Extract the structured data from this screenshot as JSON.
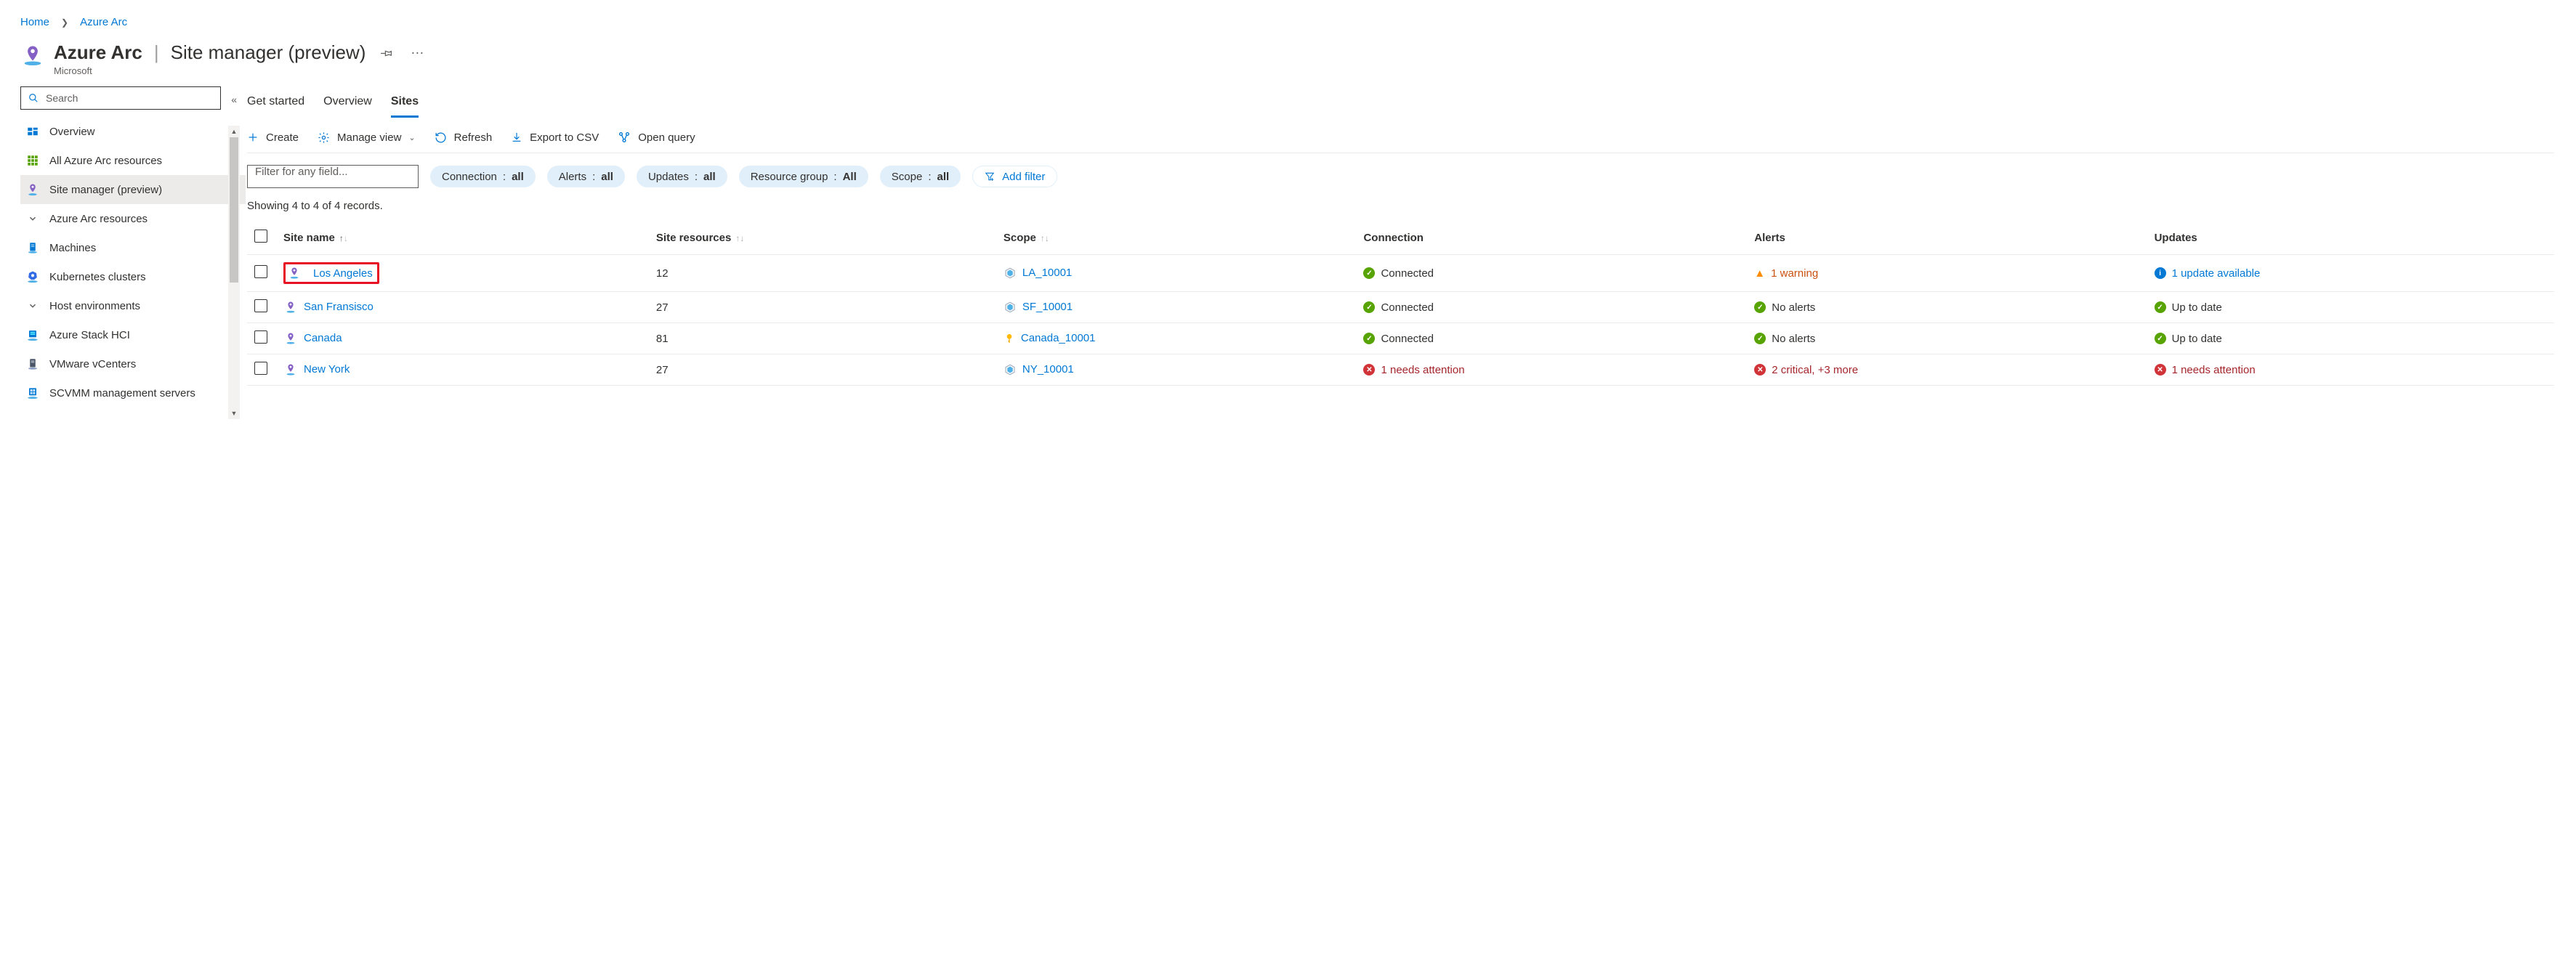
{
  "breadcrumb": {
    "home": "Home",
    "svc": "Azure Arc"
  },
  "header": {
    "service": "Azure Arc",
    "page": "Site manager (preview)",
    "publisher": "Microsoft"
  },
  "sidebar": {
    "search_placeholder": "Search",
    "items": [
      {
        "label": "Overview",
        "sel": false,
        "kind": "overview"
      },
      {
        "label": "All Azure Arc resources",
        "sel": false,
        "kind": "grid"
      },
      {
        "label": "Site manager (preview)",
        "sel": true,
        "kind": "pin"
      },
      {
        "label": "Azure Arc resources",
        "sel": false,
        "kind": "group"
      },
      {
        "label": "Machines",
        "sel": false,
        "kind": "machine"
      },
      {
        "label": "Kubernetes clusters",
        "sel": false,
        "kind": "k8s"
      },
      {
        "label": "Host environments",
        "sel": false,
        "kind": "group"
      },
      {
        "label": "Azure Stack HCI",
        "sel": false,
        "kind": "stack"
      },
      {
        "label": "VMware vCenters",
        "sel": false,
        "kind": "vmware"
      },
      {
        "label": "SCVMM management servers",
        "sel": false,
        "kind": "scvmm"
      }
    ]
  },
  "tabs": [
    {
      "label": "Get started",
      "active": false
    },
    {
      "label": "Overview",
      "active": false
    },
    {
      "label": "Sites",
      "active": true
    }
  ],
  "commands": {
    "create": "Create",
    "manage_view": "Manage view",
    "refresh": "Refresh",
    "export": "Export to CSV",
    "open_query": "Open query"
  },
  "filters": {
    "placeholder": "Filter for any field...",
    "pills": [
      {
        "key": "Connection",
        "val": "all"
      },
      {
        "key": "Alerts",
        "val": "all"
      },
      {
        "key": "Updates",
        "val": "all"
      },
      {
        "key": "Resource group",
        "val": "All"
      },
      {
        "key": "Scope",
        "val": "all"
      }
    ],
    "add": "Add filter"
  },
  "records_info": "Showing 4 to 4 of 4 records.",
  "table": {
    "cols": {
      "name": "Site name",
      "resources": "Site resources",
      "scope": "Scope",
      "connection": "Connection",
      "alerts": "Alerts",
      "updates": "Updates"
    },
    "rows": [
      {
        "name": "Los Angeles",
        "highlight": true,
        "resources": "12",
        "scope": "LA_10001",
        "scope_kind": "rg",
        "connection": {
          "state": "ok",
          "text": "Connected",
          "link": false
        },
        "alerts": {
          "state": "warn",
          "text": "1 warning",
          "link": true
        },
        "updates": {
          "state": "info",
          "text": "1 update available",
          "link": true
        }
      },
      {
        "name": "San Fransisco",
        "highlight": false,
        "resources": "27",
        "scope": "SF_10001",
        "scope_kind": "rg",
        "connection": {
          "state": "ok",
          "text": "Connected",
          "link": false
        },
        "alerts": {
          "state": "ok",
          "text": "No alerts",
          "link": false
        },
        "updates": {
          "state": "ok",
          "text": "Up to date",
          "link": false
        }
      },
      {
        "name": "Canada",
        "highlight": false,
        "resources": "81",
        "scope": "Canada_10001",
        "scope_kind": "sub",
        "connection": {
          "state": "ok",
          "text": "Connected",
          "link": false
        },
        "alerts": {
          "state": "ok",
          "text": "No alerts",
          "link": false
        },
        "updates": {
          "state": "ok",
          "text": "Up to date",
          "link": false
        }
      },
      {
        "name": "New York",
        "highlight": false,
        "resources": "27",
        "scope": "NY_10001",
        "scope_kind": "rg",
        "connection": {
          "state": "err",
          "text": "1 needs attention",
          "link": true
        },
        "alerts": {
          "state": "err",
          "text": "2 critical, +3 more",
          "link": true
        },
        "updates": {
          "state": "err",
          "text": "1 needs attention",
          "link": true
        }
      }
    ]
  }
}
